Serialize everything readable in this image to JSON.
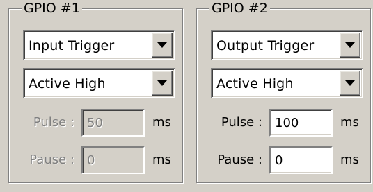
{
  "gpio1": {
    "title": "GPIO #1",
    "mode": "Input Trigger",
    "polarity": "Active High",
    "pulse_label": "Pulse :",
    "pulse_value": "50",
    "pause_label": "Pause :",
    "pause_value": "0",
    "unit": "ms",
    "enabled": false
  },
  "gpio2": {
    "title": "GPIO #2",
    "mode": "Output Trigger",
    "polarity": "Active High",
    "pulse_label": "Pulse :",
    "pulse_value": "100",
    "pause_label": "Pause :",
    "pause_value": "0",
    "unit": "ms",
    "enabled": true
  },
  "icons": {
    "dropdown": "chevron-down-icon"
  },
  "colors": {
    "background": "#d4d0c8",
    "disabled_text": "#808080",
    "field_bg": "#ffffff"
  }
}
